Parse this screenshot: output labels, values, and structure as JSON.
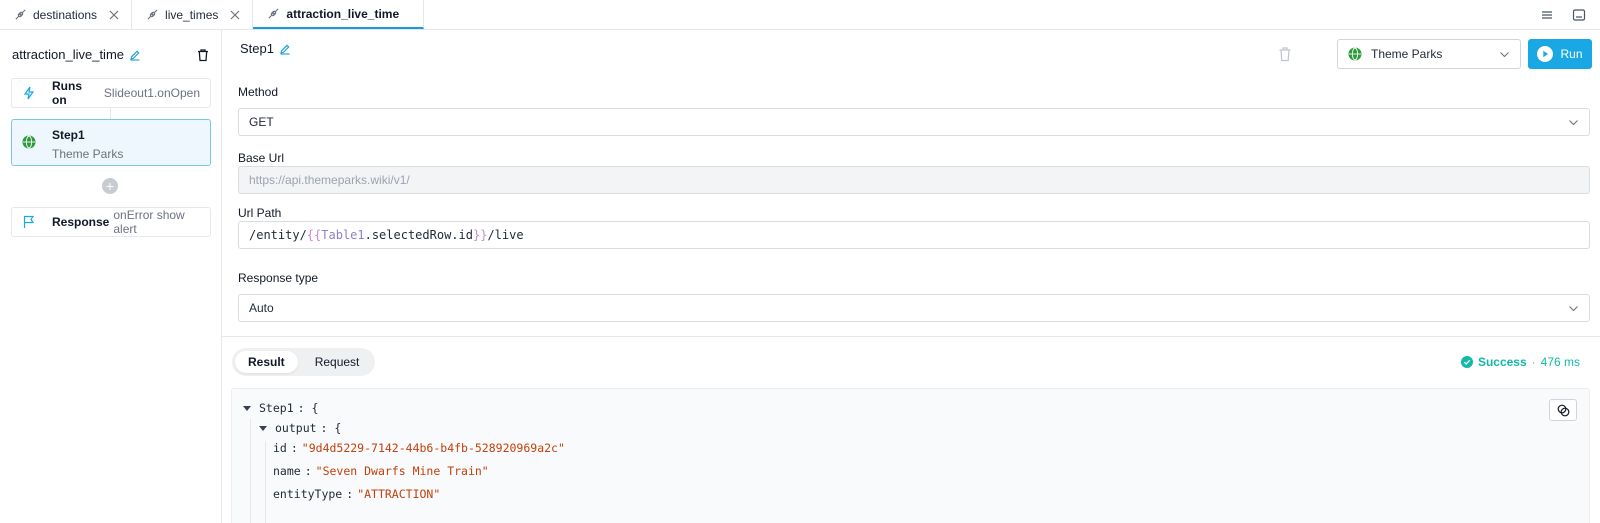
{
  "tabs": [
    {
      "label": "destinations",
      "icon": "api-connector-icon"
    },
    {
      "label": "live_times",
      "icon": "api-connector-icon"
    },
    {
      "label": "attraction_live_time",
      "icon": "api-connector-icon",
      "active": true
    }
  ],
  "sidebar": {
    "title": "attraction_live_time",
    "runs_on": {
      "label": "Runs on",
      "value": "Slideout1.onOpen"
    },
    "step": {
      "label": "Step1",
      "resource": "Theme Parks"
    },
    "response": {
      "label": "Response",
      "value": "onError show alert"
    }
  },
  "main": {
    "step_name": "Step1",
    "resource": "Theme Parks",
    "run_label": "Run",
    "method": {
      "label": "Method",
      "value": "GET"
    },
    "base_url": {
      "label": "Base Url",
      "value": "https://api.themeparks.wiki/v1/"
    },
    "url_path": {
      "label": "Url Path",
      "prefix": "/entity/",
      "open": "{{",
      "var_obj": "Table1",
      "var_rest": ".selectedRow.id",
      "close": "}}",
      "suffix": "/live"
    },
    "response_type": {
      "label": "Response type",
      "value": "Auto"
    },
    "result_tabs": [
      "Result",
      "Request"
    ],
    "status": {
      "text": "Success",
      "separator": "·",
      "time": "476 ms"
    }
  },
  "result": {
    "root_key": "Step1",
    "output_key": "output",
    "fields": [
      {
        "key": "id",
        "value": "\"9d4d5229-7142-44b6-b4fb-528920969a2c\""
      },
      {
        "key": "name",
        "value": "\"Seven Dwarfs Mine Train\""
      },
      {
        "key": "entityType",
        "value": "\"ATTRACTION\""
      }
    ]
  },
  "colors": {
    "accent": "#1aa8e4",
    "success": "#14b8a6",
    "string": "#c2410c"
  }
}
